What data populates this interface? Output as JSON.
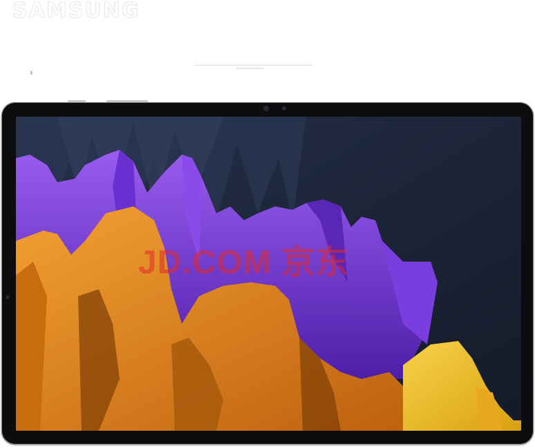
{
  "brand": {
    "logo_text": "SAMSUNG"
  },
  "watermark": {
    "text": "JD.COM 京东"
  },
  "colors": {
    "bezel": "#0d0d0f",
    "screen_bg": "#1a2132",
    "purple": "#7b3fe0",
    "orange": "#e8891a",
    "yellow": "#f2c230"
  }
}
